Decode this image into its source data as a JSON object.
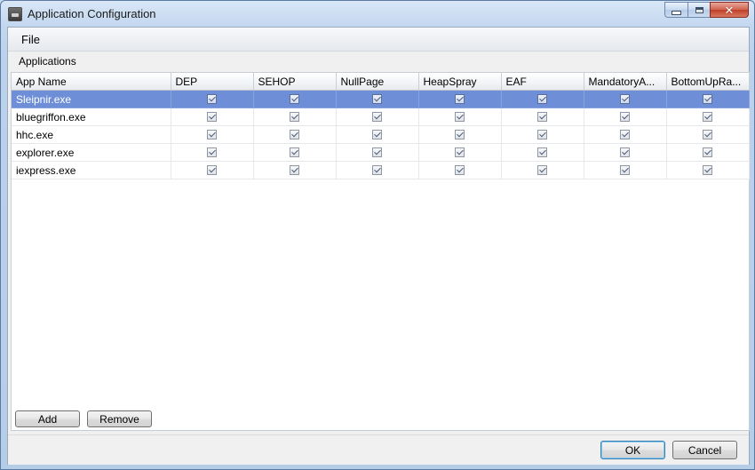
{
  "window": {
    "title": "Application Configuration",
    "close_glyph": "✕"
  },
  "menu": {
    "file": "File"
  },
  "group": {
    "label": "Applications"
  },
  "table": {
    "columns": [
      "App Name",
      "DEP",
      "SEHOP",
      "NullPage",
      "HeapSpray",
      "EAF",
      "MandatoryA...",
      "BottomUpRa..."
    ],
    "rows": [
      {
        "name": "Sleipnir.exe",
        "selected": true,
        "checks": [
          true,
          true,
          true,
          true,
          true,
          true,
          true
        ]
      },
      {
        "name": "bluegriffon.exe",
        "selected": false,
        "checks": [
          true,
          true,
          true,
          true,
          true,
          true,
          true
        ]
      },
      {
        "name": "hhc.exe",
        "selected": false,
        "checks": [
          true,
          true,
          true,
          true,
          true,
          true,
          true
        ]
      },
      {
        "name": "explorer.exe",
        "selected": false,
        "checks": [
          true,
          true,
          true,
          true,
          true,
          true,
          true
        ]
      },
      {
        "name": "iexpress.exe",
        "selected": false,
        "checks": [
          true,
          true,
          true,
          true,
          true,
          true,
          true
        ]
      }
    ]
  },
  "buttons": {
    "add": "Add",
    "remove": "Remove",
    "ok": "OK",
    "cancel": "Cancel"
  },
  "colors": {
    "selection": "#6e8fd8",
    "title_bar": "#c3d7ef"
  },
  "icons": {
    "app": "app-window-icon",
    "minimize": "minimize-icon",
    "maximize": "maximize-icon",
    "close": "close-icon",
    "checkbox": "checkbox-checked-icon"
  }
}
